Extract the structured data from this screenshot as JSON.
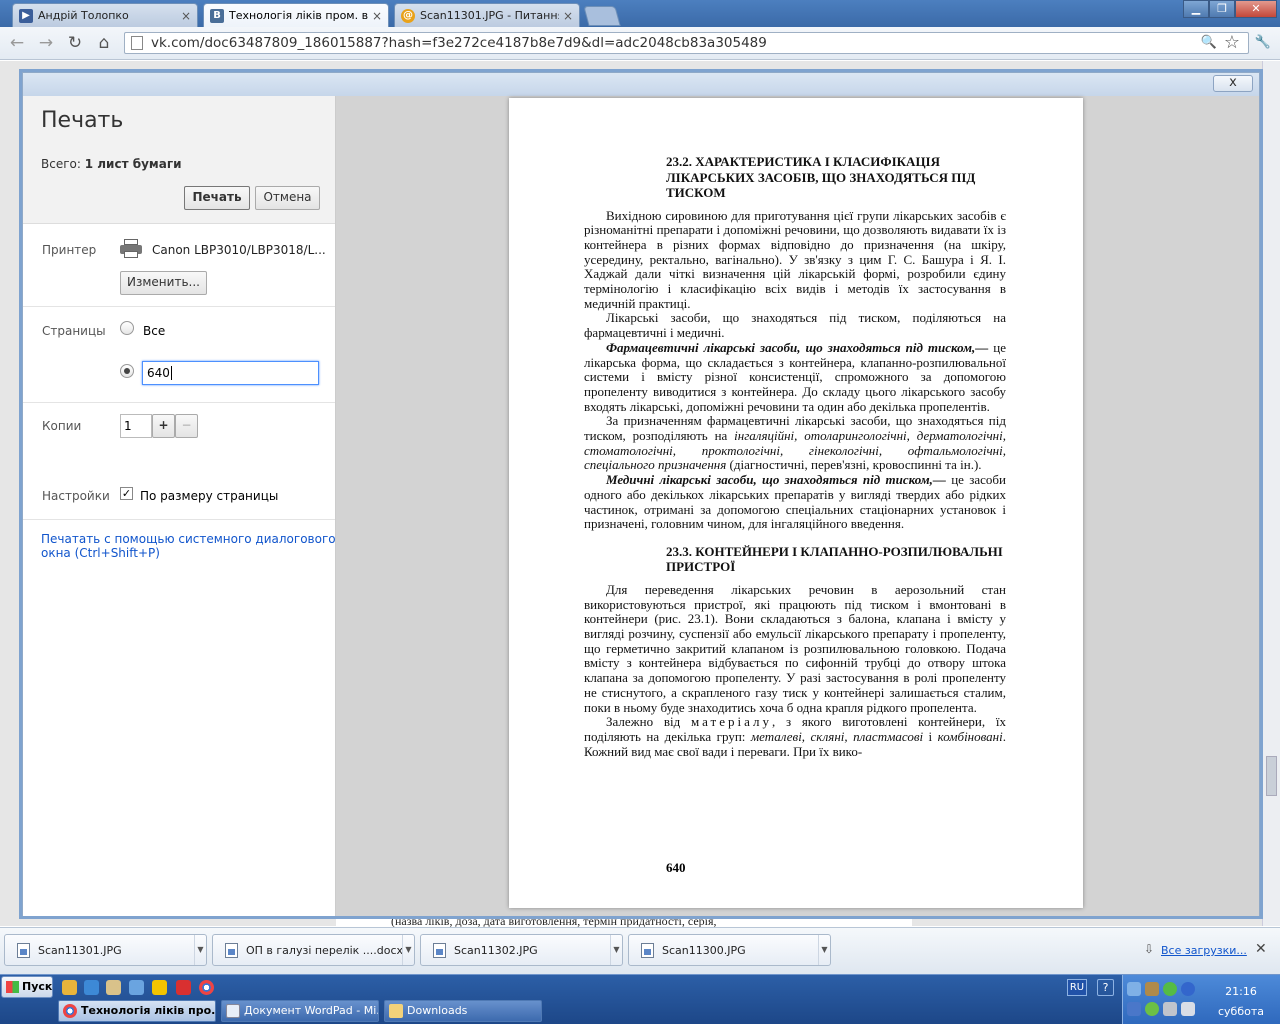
{
  "tabs": [
    {
      "title": "Андрій Толопко",
      "icon": "video-icon",
      "close": "×"
    },
    {
      "title": "Технологія ліків пром. ви-ц",
      "icon": "vk-icon",
      "close": "×",
      "active": true
    },
    {
      "title": "Scan11301.JPG - Питання д",
      "icon": "mail-icon",
      "close": "×"
    }
  ],
  "window": {
    "minimize": "▁",
    "restore": "❐",
    "close": "✕"
  },
  "toolbar": {
    "url": "vk.com/doc63487809_186015887?hash=f3e272ce4187b8e7d9&dl=adc2048cb83a305489",
    "back": "←",
    "forward": "→",
    "reload": "↻",
    "home": "⌂",
    "zoom": "🔍",
    "star": "☆",
    "wrench": "🔧"
  },
  "print": {
    "title": "Печать",
    "total_label": "Всего:",
    "total_value": "1 лист бумаги",
    "print_button": "Печать",
    "cancel_button": "Отмена",
    "printer_label": "Принтер",
    "printer_name": "Canon LBP3010/LBP3018/L...",
    "change_button": "Изменить...",
    "pages_label": "Страницы",
    "pages_all": "Все",
    "pages_value": "640",
    "copies_label": "Копии",
    "copies_value": "1",
    "copies_plus": "+",
    "copies_minus": "−",
    "settings_label": "Настройки",
    "fit_label": "По размеру страницы",
    "system_dialog_link": "Печатать с помощью системного диалогового окна (Ctrl+Shift+P)",
    "close": "x"
  },
  "doc": {
    "h1": "23.2. ХАРАКТЕРИСТИКА І КЛАСИФІКАЦІЯ ЛІКАРСЬКИХ ЗАСОБІВ, ЩО ЗНАХОДЯТЬСЯ ПІД ТИСКОМ",
    "p1": "Вихідною сировиною для приготування цієї групи лікарських засобів є різноманітні препарати і допоміжні речовини, що дозволяють видавати їх із контейнера в різних формах відповідно до призначення (на шкіру, усередину, ректально, вагінально). У зв'язку з цим Г. С. Башура і Я. І. Хаджай дали чіткі визначення цій лікарській формі, розробили єдину термінологію і класифікацію всіх видів і методів їх застосування в медичній практиці.",
    "p2": "Лікарські засоби, що знаходяться під тиском, поділяються на фармацевтичні і медичні.",
    "p3_term": "Фармацевтичні лікарські засоби, що знаходяться під тиском,—",
    "p3": " це лікарська форма, що складається з контейнера, клапанно-розпилювальної системи і вмісту різної консистенції, спроможного за допомогою пропеленту виводитися з контейнера. До складу цього лікарського засобу входять лікарські, допоміжні речовини та один або декілька пропелентів.",
    "p4a": "За призначенням фармацевтичні лікарські засоби, що знаходяться під тиском, розподіляють на ",
    "p4_italic": "інгаляційні, отоларингологічні, дерматологічні, стоматологічні, проктологічні, гінекологічні, офтальмологічні, спеціального призначення",
    "p4b": " (діагностичні, перев'язні, кровоспинні та ін.).",
    "p5_term": "Медичні лікарські засоби, що знаходяться під тиском,—",
    "p5": " це засоби одного або декількох лікарських препаратів у вигляді твердих або рідких частинок, отримані за допомогою спеціальних стаціонарних установок і призначені, головним чином, для інгаляційного введення.",
    "h2": "23.3. КОНТЕЙНЕРИ І КЛАПАННО-РОЗПИЛЮВАЛЬНІ ПРИСТРОЇ",
    "p6": "Для переведення лікарських речовин в аерозольний стан використовуються пристрої, які працюють під тиском і вмонтовані в контейнери (рис. 23.1). Вони складаються з балона, клапана і вмісту у вигляді розчину, суспензії або емульсії лікарського препарату і пропеленту, що герметично закритий клапаном із розпилювальною головкою. Подача вмісту з контейнера відбувається по сифонній трубці до отвору штока клапана за допомогою пропеленту. У разі застосування в ролі пропеленту не стиснутого, а скрапленого газу тиск у контейнері залишається сталим, поки в ньому буде знаходитись хоча б одна крапля рідкого пропелента.",
    "p7a": "Залежно від ",
    "p7_spaced": "матеріалу",
    "p7b": ", з якого виготовлені контейнери, їх поділяють на декілька груп: ",
    "p7_italic": "металеві, скляні, пластмасові",
    "p7c": " і ",
    "p7_italic2": "комбіновані",
    "p7d": ". Кожний вид має свої вади і переваги. При їх вико-",
    "page_number": "640"
  },
  "bg_text": "(назва ліків, доза, дата виготовлення, термін придатності, серія,",
  "downloads": [
    {
      "name": "Scan11301.JPG",
      "arrow": "▼"
    },
    {
      "name": "ОП в галузі перелік ....docx",
      "arrow": "▼"
    },
    {
      "name": "Scan11302.JPG",
      "arrow": "▼"
    },
    {
      "name": "Scan11300.JPG",
      "arrow": "▼"
    }
  ],
  "downloads_all": "Все загрузки...",
  "downloads_close": "✕",
  "taskbar": {
    "start": "Пуск",
    "tasks": [
      {
        "label": "Технологія ліків про..."
      },
      {
        "label": "Документ WordPad - Mi..."
      },
      {
        "label": "Downloads"
      }
    ],
    "lang": "RU",
    "help": "?",
    "time": "21:16",
    "day": "суббота"
  },
  "colors": {
    "accent": "#1c55b5",
    "link": "#1155cc",
    "taskbar": "#245ca6"
  }
}
